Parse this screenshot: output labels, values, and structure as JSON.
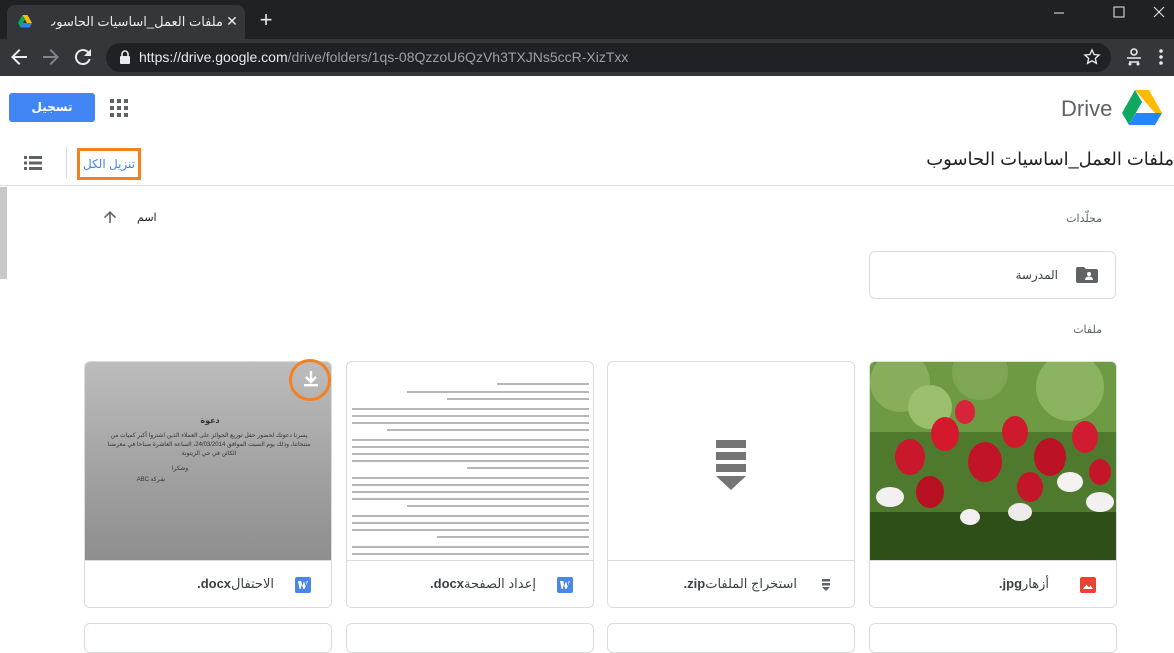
{
  "browser": {
    "tab_title": "ملفات العمل_اساسيات الحاسوب - ...",
    "url_host": "https://drive.google.com",
    "url_path": "/drive/folders/1qs-08QzzoU6QzVh3TXJNs5ccR-XizTxx"
  },
  "header": {
    "signin_label": "تسجيل الدخول",
    "brand": "Drive"
  },
  "subheader": {
    "download_all_label": "تنزيل الكل",
    "folder_title": "ملفات العمل_اساسيات الحاسوب"
  },
  "sort": {
    "label": "اسم"
  },
  "sections": {
    "folders_label": "مجلّدات",
    "files_label": "ملفات"
  },
  "folders": [
    {
      "name": "المدرسة"
    }
  ],
  "files": [
    {
      "name": "أزهار",
      "ext": "jpg.",
      "type": "image-icon"
    },
    {
      "name": "استخراج الملفات",
      "ext": "zip.",
      "type": "archive-icon"
    },
    {
      "name": "إعداد الصفحة",
      "ext": "docx.",
      "type": "word-icon"
    },
    {
      "name": "الاحتفال",
      "ext": "docx.",
      "type": "word-icon"
    }
  ],
  "doc_preview": {
    "heading": "دعوة",
    "body": "يسرنا دعوتك لحضور حفل توزيع الجوائز على العملاء الذين اشتروا أكبر كميات من منتجاتنا، وذلك يوم السبت الموافق 24/03/2014، الساعة العاشرة صباحا في معرضنا الكائن في حي الزيتونة",
    "thanks": "وشكرا",
    "signature": "شركة ABC"
  },
  "colors": {
    "accent_blue": "#4285f4",
    "highlight_orange": "#f4811f",
    "word_blue": "#4a86e8",
    "image_red": "#ea4335"
  }
}
